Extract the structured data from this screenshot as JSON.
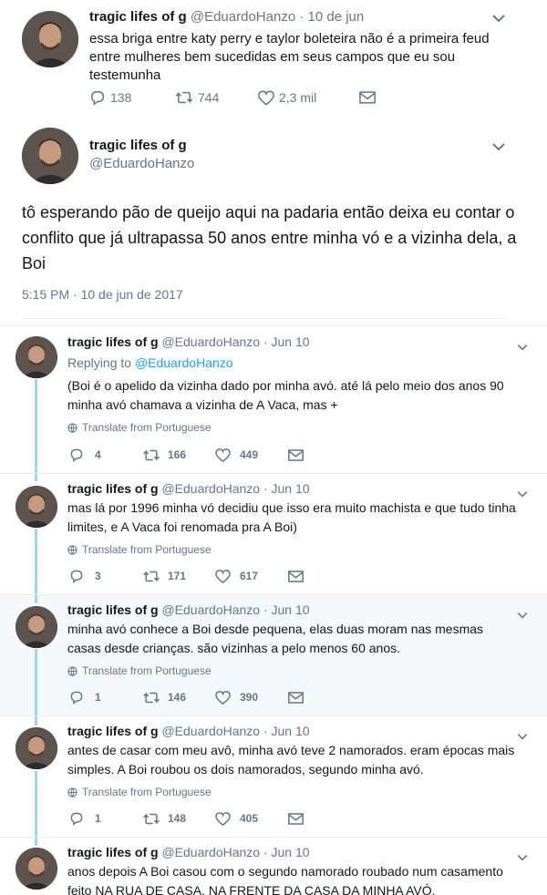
{
  "top_tweet": {
    "name": "tragic lifes of g",
    "handle": "@EduardoHanzo",
    "date": "· 10 de jun",
    "text": "essa briga entre katy perry e taylor boleteira não é a primeira feud entre mulheres bem sucedidas em seus campos que eu sou testemunha",
    "replies": "138",
    "retweets": "744",
    "likes": "2,3 mil"
  },
  "main_tweet": {
    "name": "tragic lifes of g",
    "handle": "@EduardoHanzo",
    "text": "tô esperando pão de queijo aqui na padaria então deixa eu contar o conflito que já ultrapassa 50 anos entre minha vó e a vizinha dela, a Boi",
    "timestamp": "5:15 PM · 10 de jun de 2017"
  },
  "thread": [
    {
      "name": "tragic lifes of g",
      "handle": "@EduardoHanzo · Jun 10",
      "replying_prefix": "Replying to ",
      "replying_handle": "@EduardoHanzo",
      "text": "(Boi é o apelido da vizinha dado por minha avó. até lá pelo meio dos anos 90 minha avó chamava a vizinha de A Vaca, mas +",
      "translate": "Translate from Portuguese",
      "replies": "4",
      "retweets": "166",
      "likes": "449"
    },
    {
      "name": "tragic lifes of g",
      "handle": "@EduardoHanzo · Jun 10",
      "text": "mas lá por 1996 minha vó decidiu que isso era muito machista e que tudo tinha limites, e A Vaca foi renomada pra A Boi)",
      "translate": "Translate from Portuguese",
      "replies": "3",
      "retweets": "171",
      "likes": "617"
    },
    {
      "name": "tragic lifes of g",
      "handle": "@EduardoHanzo · Jun 10",
      "text": "minha avó conhece a Boi desde pequena, elas duas moram nas mesmas casas desde crianças. são vizinhas a pelo menos 60 anos.",
      "translate": "Translate from Portuguese",
      "replies": "1",
      "retweets": "146",
      "likes": "390"
    },
    {
      "name": "tragic lifes of g",
      "handle": "@EduardoHanzo · Jun 10",
      "text": "antes de casar com meu avô, minha avó teve 2 namorados. eram épocas mais simples. A Boi roubou os dois namorados, segundo minha avó.",
      "translate": "Translate from Portuguese",
      "replies": "1",
      "retweets": "148",
      "likes": "405"
    },
    {
      "name": "tragic lifes of g",
      "handle": "@EduardoHanzo · Jun 10",
      "text": "anos depois A Boi casou com o segundo namorado roubado num casamento feito NA RUA DE CASA, NA FRENTE DA CASA DA MINHA AVÓ."
    }
  ],
  "colors": {
    "thread_line": "#9fd3ee",
    "link": "#1da1f2",
    "muted": "#657786",
    "highlight_bg": "#f5f8fa"
  }
}
